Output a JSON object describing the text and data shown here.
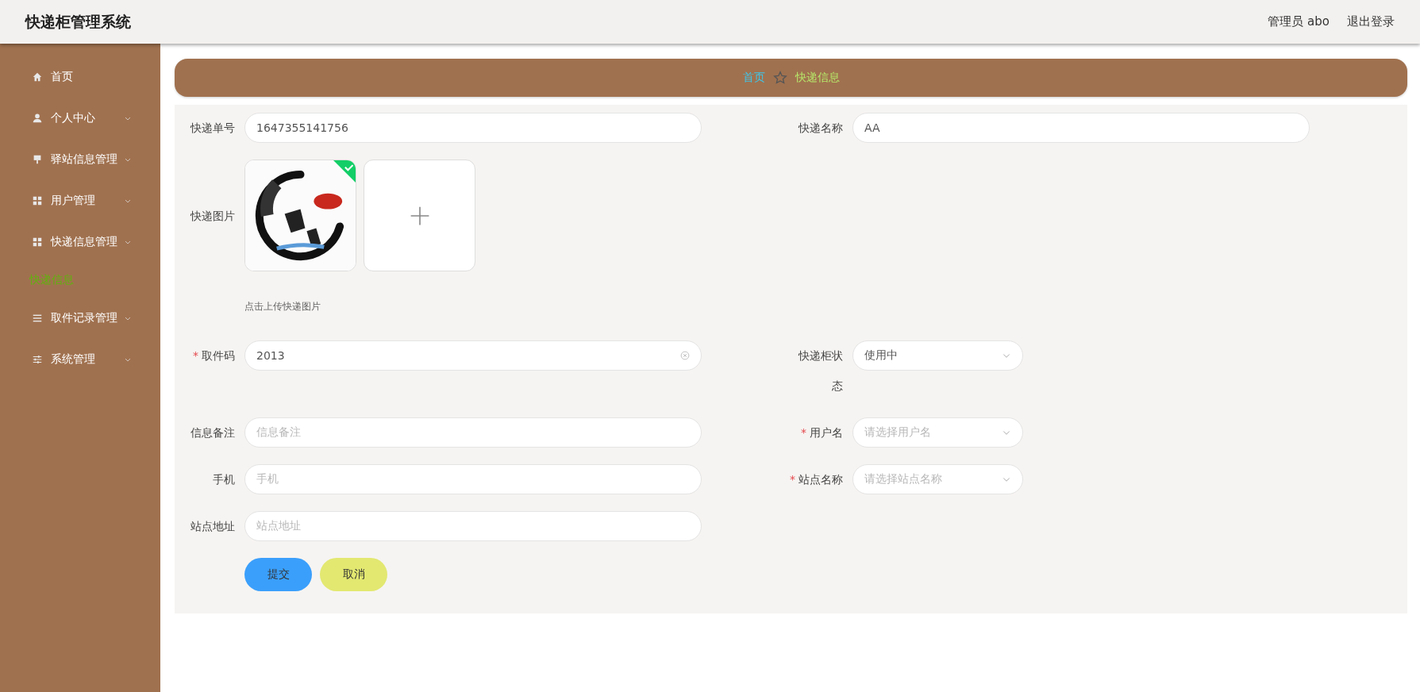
{
  "header": {
    "title": "快递柜管理系统",
    "user": "管理员 abo",
    "logout": "退出登录"
  },
  "sidebar": {
    "items": [
      {
        "label": "首页",
        "has_arrow": false,
        "selected": false
      },
      {
        "label": "个人中心",
        "has_arrow": true,
        "selected": false
      },
      {
        "label": "驿站信息管理",
        "has_arrow": true,
        "selected": false
      },
      {
        "label": "用户管理",
        "has_arrow": true,
        "selected": false
      },
      {
        "label": "快递信息管理",
        "has_arrow": true,
        "selected": false,
        "children": [
          {
            "label": "快递信息",
            "selected": true
          }
        ]
      },
      {
        "label": "取件记录管理",
        "has_arrow": true,
        "selected": false
      },
      {
        "label": "系统管理",
        "has_arrow": true,
        "selected": false
      }
    ]
  },
  "breadcrumb": [
    {
      "label": "首页",
      "current": false
    },
    {
      "label": "快递信息",
      "current": true
    }
  ],
  "form": {
    "rows": [
      [
        {
          "kind": "text",
          "label": "快递单号",
          "value": "1647355141756"
        },
        {
          "kind": "text",
          "label": "快递名称",
          "value": "AA"
        }
      ],
      [
        {
          "kind": "upload",
          "label": "快递图片",
          "uploaded": true,
          "hint": "点击上传快递图片"
        }
      ],
      [
        {
          "kind": "text",
          "label": "取件码",
          "required_mark": "*",
          "value": "2013",
          "clearable": true
        },
        {
          "kind": "select",
          "label": "快递柜状态",
          "value": "使用中"
        }
      ],
      [
        {
          "kind": "text",
          "label": "信息备注",
          "placeholder": "信息备注"
        },
        {
          "kind": "select",
          "label": "用户名",
          "required_mark": "*",
          "placeholder": "请选择用户名"
        }
      ],
      [
        {
          "kind": "text",
          "label": "手机",
          "placeholder": "手机"
        },
        {
          "kind": "select",
          "label": "站点名称",
          "required_mark": "*",
          "placeholder": "请选择站点名称"
        }
      ],
      [
        {
          "kind": "text",
          "label": "站点地址",
          "placeholder": "站点地址"
        }
      ]
    ],
    "buttons": [
      {
        "label": "提交",
        "kind": "primary"
      },
      {
        "label": "取消",
        "kind": "cancel"
      }
    ]
  }
}
